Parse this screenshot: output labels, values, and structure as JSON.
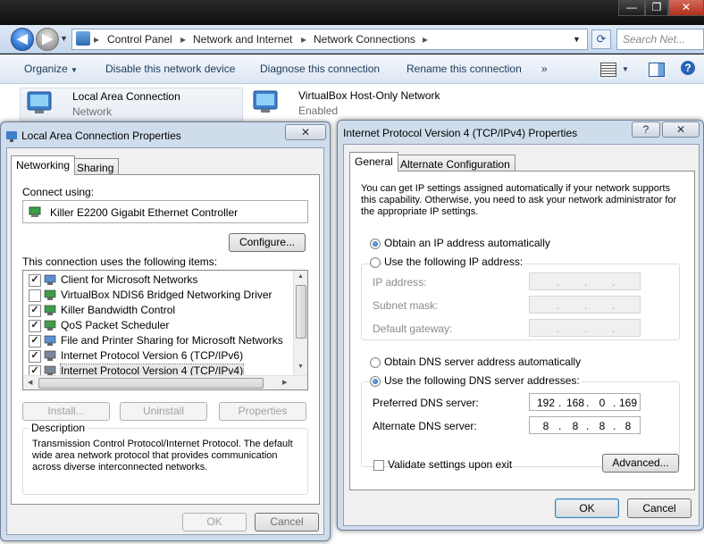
{
  "explorer": {
    "title_buttons": {
      "minimize": "—",
      "maximize": "❐",
      "close": "✕"
    },
    "breadcrumb": [
      "Control Panel",
      "Network and Internet",
      "Network Connections"
    ],
    "search_placeholder": "Search Net...",
    "toolbar": {
      "organize": "Organize",
      "disable": "Disable this network device",
      "diagnose": "Diagnose this connection",
      "rename": "Rename this connection",
      "more": "»"
    },
    "connections": [
      {
        "name": "Local Area Connection",
        "status": "Network"
      },
      {
        "name": "VirtualBox Host-Only Network",
        "status": "Enabled"
      }
    ]
  },
  "lac_dialog": {
    "title": "Local Area Connection Properties",
    "close": "✕",
    "tabs": [
      "Networking",
      "Sharing"
    ],
    "connect_using_label": "Connect using:",
    "adapter": "Killer E2200 Gigabit Ethernet Controller",
    "configure": "Configure...",
    "items_label": "This connection uses the following items:",
    "items": [
      {
        "label": "Client for Microsoft Networks",
        "checked": true
      },
      {
        "label": "VirtualBox NDIS6 Bridged Networking Driver",
        "checked": false
      },
      {
        "label": "Killer Bandwidth Control",
        "checked": true
      },
      {
        "label": "QoS Packet Scheduler",
        "checked": true
      },
      {
        "label": "File and Printer Sharing for Microsoft Networks",
        "checked": true
      },
      {
        "label": "Internet Protocol Version 6 (TCP/IPv6)",
        "checked": true
      },
      {
        "label": "Internet Protocol Version 4 (TCP/IPv4)",
        "checked": true
      }
    ],
    "install": "Install...",
    "uninstall": "Uninstall",
    "properties": "Properties",
    "description_label": "Description",
    "description": "Transmission Control Protocol/Internet Protocol. The default wide area network protocol that provides communication across diverse interconnected networks.",
    "ok": "OK",
    "cancel": "Cancel"
  },
  "ipv4_dialog": {
    "title": "Internet Protocol Version 4 (TCP/IPv4) Properties",
    "help": "?",
    "close": "✕",
    "tabs": [
      "General",
      "Alternate Configuration"
    ],
    "intro": "You can get IP settings assigned automatically if your network supports this capability. Otherwise, you need to ask your network administrator for the appropriate IP settings.",
    "obtain_ip": "Obtain an IP address automatically",
    "use_ip": "Use the following IP address:",
    "ip_address": "IP address:",
    "subnet_mask": "Subnet mask:",
    "default_gateway": "Default gateway:",
    "obtain_dns": "Obtain DNS server address automatically",
    "use_dns": "Use the following DNS server addresses:",
    "preferred_dns": "Preferred DNS server:",
    "alternate_dns": "Alternate DNS server:",
    "preferred_dns_value": [
      "192",
      "168",
      "0",
      "169"
    ],
    "alternate_dns_value": [
      "8",
      "8",
      "8",
      "8"
    ],
    "validate": "Validate settings upon exit",
    "advanced": "Advanced...",
    "ok": "OK",
    "cancel": "Cancel",
    "empty_octets": [
      ".",
      ".",
      "."
    ]
  }
}
